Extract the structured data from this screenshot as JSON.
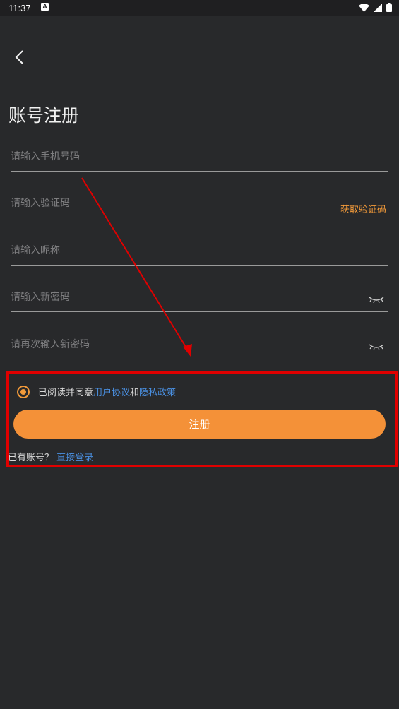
{
  "status_bar": {
    "time": "11:37",
    "notification_glyph": "A"
  },
  "nav": {
    "back_icon": "chevron-left-icon"
  },
  "page": {
    "title": "账号注册"
  },
  "form": {
    "phone_placeholder": "请输入手机号码",
    "code_placeholder": "请输入验证码",
    "get_code_label": "获取验证码",
    "nickname_placeholder": "请输入昵称",
    "password_placeholder": "请输入新密码",
    "confirm_password_placeholder": "请再次输入新密码"
  },
  "agreement": {
    "prefix": "已阅读并同意",
    "user_agreement": "用户协议",
    "conjunction": "和",
    "privacy_policy": "隐私政策",
    "checked": true
  },
  "register_button": {
    "label": "注册"
  },
  "login_prompt": {
    "text": "已有账号？",
    "link": "直接登录"
  },
  "colors": {
    "accent": "#f49138",
    "link": "#4a90e2",
    "annotation": "#e00000",
    "background": "#28292b"
  }
}
